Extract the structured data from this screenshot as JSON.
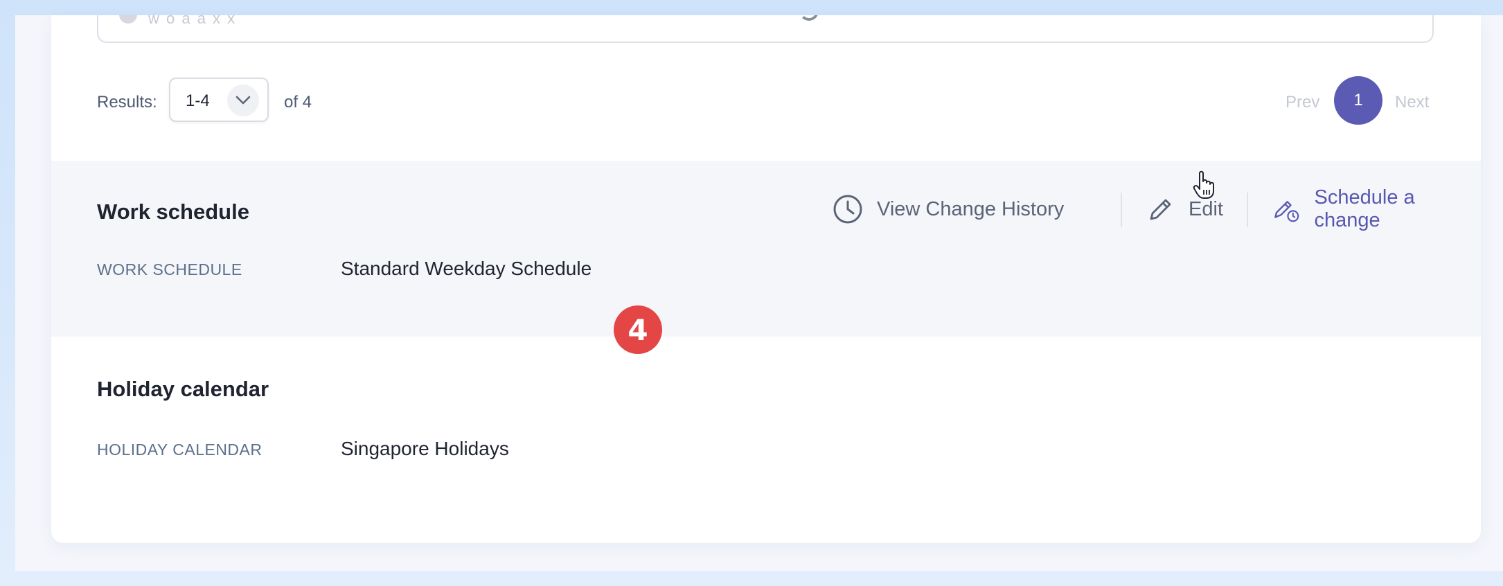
{
  "top_field": {
    "partial_text": "w o a a x x"
  },
  "pagination": {
    "results_label": "Results:",
    "range_value": "1-4",
    "of_label": "of 4",
    "prev_label": "Prev",
    "current_page": "1",
    "next_label": "Next"
  },
  "work_schedule": {
    "title": "Work schedule",
    "actions": {
      "history_label": "View Change History",
      "edit_label": "Edit",
      "schedule_change_label": "Schedule a change"
    },
    "field_label": "WORK SCHEDULE",
    "field_value": "Standard Weekday Schedule"
  },
  "holiday_calendar": {
    "title": "Holiday calendar",
    "field_label": "HOLIDAY CALENDAR",
    "field_value": "Singapore Holidays"
  },
  "step_badge": "4",
  "colors": {
    "accent": "#5b5bb3",
    "badge": "#e44545",
    "label": "#5c6f8a"
  }
}
